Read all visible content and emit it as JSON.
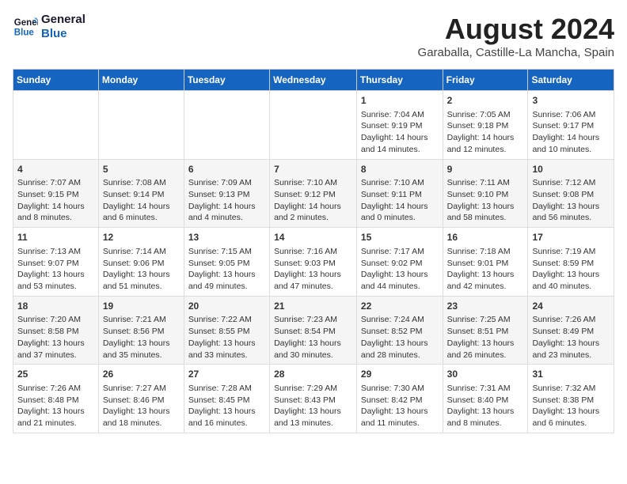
{
  "logo": {
    "line1": "General",
    "line2": "Blue"
  },
  "title": "August 2024",
  "subtitle": "Garaballa, Castille-La Mancha, Spain",
  "days_header": [
    "Sunday",
    "Monday",
    "Tuesday",
    "Wednesday",
    "Thursday",
    "Friday",
    "Saturday"
  ],
  "weeks": [
    [
      {
        "day": "",
        "content": ""
      },
      {
        "day": "",
        "content": ""
      },
      {
        "day": "",
        "content": ""
      },
      {
        "day": "",
        "content": ""
      },
      {
        "day": "1",
        "content": "Sunrise: 7:04 AM\nSunset: 9:19 PM\nDaylight: 14 hours\nand 14 minutes."
      },
      {
        "day": "2",
        "content": "Sunrise: 7:05 AM\nSunset: 9:18 PM\nDaylight: 14 hours\nand 12 minutes."
      },
      {
        "day": "3",
        "content": "Sunrise: 7:06 AM\nSunset: 9:17 PM\nDaylight: 14 hours\nand 10 minutes."
      }
    ],
    [
      {
        "day": "4",
        "content": "Sunrise: 7:07 AM\nSunset: 9:15 PM\nDaylight: 14 hours\nand 8 minutes."
      },
      {
        "day": "5",
        "content": "Sunrise: 7:08 AM\nSunset: 9:14 PM\nDaylight: 14 hours\nand 6 minutes."
      },
      {
        "day": "6",
        "content": "Sunrise: 7:09 AM\nSunset: 9:13 PM\nDaylight: 14 hours\nand 4 minutes."
      },
      {
        "day": "7",
        "content": "Sunrise: 7:10 AM\nSunset: 9:12 PM\nDaylight: 14 hours\nand 2 minutes."
      },
      {
        "day": "8",
        "content": "Sunrise: 7:10 AM\nSunset: 9:11 PM\nDaylight: 14 hours\nand 0 minutes."
      },
      {
        "day": "9",
        "content": "Sunrise: 7:11 AM\nSunset: 9:10 PM\nDaylight: 13 hours\nand 58 minutes."
      },
      {
        "day": "10",
        "content": "Sunrise: 7:12 AM\nSunset: 9:08 PM\nDaylight: 13 hours\nand 56 minutes."
      }
    ],
    [
      {
        "day": "11",
        "content": "Sunrise: 7:13 AM\nSunset: 9:07 PM\nDaylight: 13 hours\nand 53 minutes."
      },
      {
        "day": "12",
        "content": "Sunrise: 7:14 AM\nSunset: 9:06 PM\nDaylight: 13 hours\nand 51 minutes."
      },
      {
        "day": "13",
        "content": "Sunrise: 7:15 AM\nSunset: 9:05 PM\nDaylight: 13 hours\nand 49 minutes."
      },
      {
        "day": "14",
        "content": "Sunrise: 7:16 AM\nSunset: 9:03 PM\nDaylight: 13 hours\nand 47 minutes."
      },
      {
        "day": "15",
        "content": "Sunrise: 7:17 AM\nSunset: 9:02 PM\nDaylight: 13 hours\nand 44 minutes."
      },
      {
        "day": "16",
        "content": "Sunrise: 7:18 AM\nSunset: 9:01 PM\nDaylight: 13 hours\nand 42 minutes."
      },
      {
        "day": "17",
        "content": "Sunrise: 7:19 AM\nSunset: 8:59 PM\nDaylight: 13 hours\nand 40 minutes."
      }
    ],
    [
      {
        "day": "18",
        "content": "Sunrise: 7:20 AM\nSunset: 8:58 PM\nDaylight: 13 hours\nand 37 minutes."
      },
      {
        "day": "19",
        "content": "Sunrise: 7:21 AM\nSunset: 8:56 PM\nDaylight: 13 hours\nand 35 minutes."
      },
      {
        "day": "20",
        "content": "Sunrise: 7:22 AM\nSunset: 8:55 PM\nDaylight: 13 hours\nand 33 minutes."
      },
      {
        "day": "21",
        "content": "Sunrise: 7:23 AM\nSunset: 8:54 PM\nDaylight: 13 hours\nand 30 minutes."
      },
      {
        "day": "22",
        "content": "Sunrise: 7:24 AM\nSunset: 8:52 PM\nDaylight: 13 hours\nand 28 minutes."
      },
      {
        "day": "23",
        "content": "Sunrise: 7:25 AM\nSunset: 8:51 PM\nDaylight: 13 hours\nand 26 minutes."
      },
      {
        "day": "24",
        "content": "Sunrise: 7:26 AM\nSunset: 8:49 PM\nDaylight: 13 hours\nand 23 minutes."
      }
    ],
    [
      {
        "day": "25",
        "content": "Sunrise: 7:26 AM\nSunset: 8:48 PM\nDaylight: 13 hours\nand 21 minutes."
      },
      {
        "day": "26",
        "content": "Sunrise: 7:27 AM\nSunset: 8:46 PM\nDaylight: 13 hours\nand 18 minutes."
      },
      {
        "day": "27",
        "content": "Sunrise: 7:28 AM\nSunset: 8:45 PM\nDaylight: 13 hours\nand 16 minutes."
      },
      {
        "day": "28",
        "content": "Sunrise: 7:29 AM\nSunset: 8:43 PM\nDaylight: 13 hours\nand 13 minutes."
      },
      {
        "day": "29",
        "content": "Sunrise: 7:30 AM\nSunset: 8:42 PM\nDaylight: 13 hours\nand 11 minutes."
      },
      {
        "day": "30",
        "content": "Sunrise: 7:31 AM\nSunset: 8:40 PM\nDaylight: 13 hours\nand 8 minutes."
      },
      {
        "day": "31",
        "content": "Sunrise: 7:32 AM\nSunset: 8:38 PM\nDaylight: 13 hours\nand 6 minutes."
      }
    ]
  ]
}
